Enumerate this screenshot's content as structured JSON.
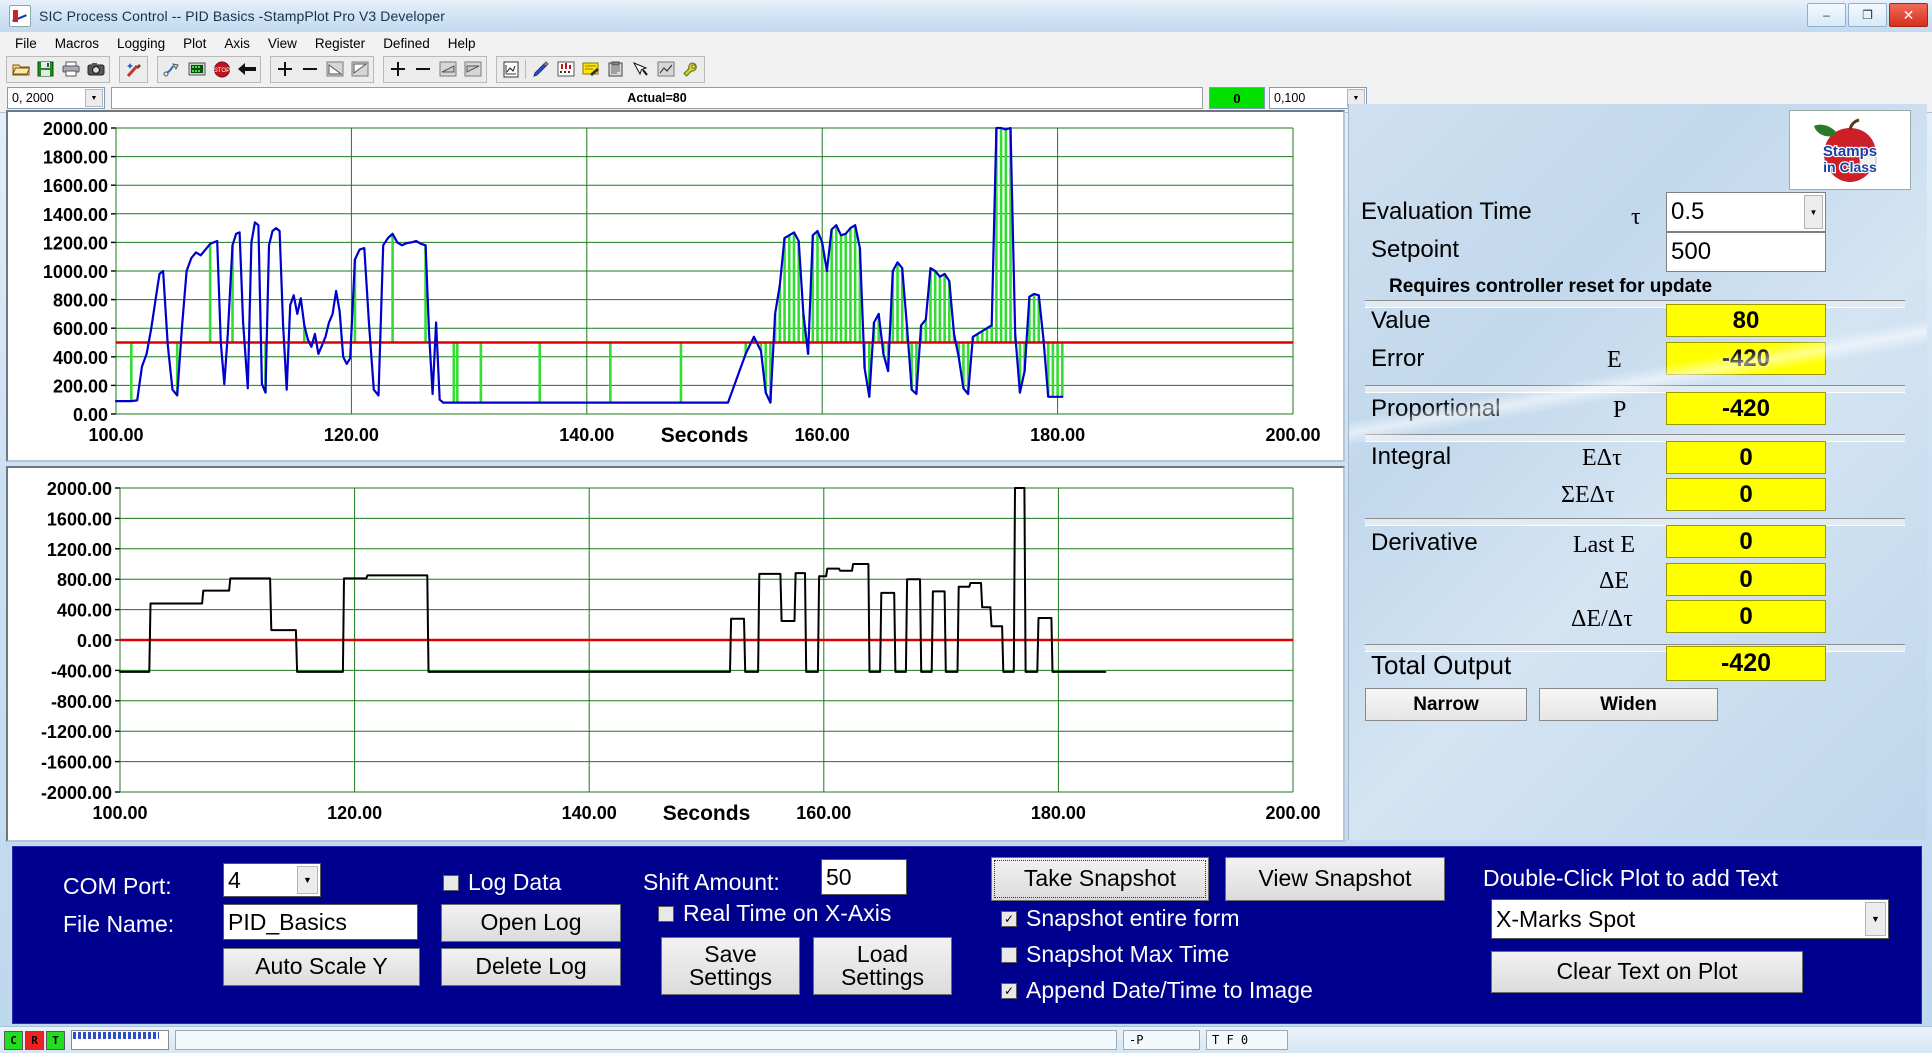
{
  "window": {
    "title": "SIC Process Control -- PID Basics -StampPlot Pro V3 Developer",
    "minimize": "–",
    "maximize": "❐",
    "close": "✕"
  },
  "menu": [
    "File",
    "Macros",
    "Logging",
    "Plot",
    "Axis",
    "View",
    "Register",
    "Defined",
    "Help"
  ],
  "toolbar": {
    "groups": [
      [
        "open-icon",
        "save-icon",
        "print-icon",
        "camera-icon"
      ],
      [
        "wand-icon"
      ],
      [
        "connect-icon",
        "terminal-icon",
        "stop-icon",
        "back-arrow-icon"
      ],
      [
        "plus-icon",
        "minus-icon",
        "scale-up-icon",
        "scale-down-icon"
      ],
      [
        "plus2-icon",
        "minus2-icon",
        "shift-left-icon",
        "shift-right-icon"
      ],
      [
        "graph-icon",
        "pen-icon",
        "marks-icon",
        "notes-icon",
        "clipboard-icon",
        "pointer-icon",
        "trend-icon",
        "wrench-icon"
      ]
    ]
  },
  "fieldrow": {
    "y_range": "0, 2000",
    "actual": "Actual=80",
    "indicator": "0",
    "x_range": "0,100"
  },
  "chart_data": [
    {
      "type": "line",
      "name": "process-value-plot",
      "title": "",
      "xlabel": "Seconds",
      "ylabel": "",
      "xlim": [
        100,
        200
      ],
      "ylim": [
        0,
        2000
      ],
      "xticks": [
        "100.00",
        "120.00",
        "140.00",
        "160.00",
        "180.00",
        "200.00"
      ],
      "yticks": [
        "0.00",
        "200.00",
        "400.00",
        "600.00",
        "800.00",
        "1000.00",
        "1200.00",
        "1400.00",
        "1600.00",
        "1800.00",
        "2000.00"
      ],
      "grid": true,
      "legend": "none",
      "series": [
        {
          "name": "Value",
          "color": "#0000cc",
          "x": [
            100.0,
            100.4,
            101.3,
            101.8,
            102.2,
            102.6,
            103.0,
            103.4,
            103.7,
            104.0,
            104.4,
            104.8,
            105.2,
            105.6,
            106.0,
            106.4,
            106.8,
            107.2,
            107.6,
            108.0,
            108.3,
            108.6,
            108.9,
            109.2,
            109.5,
            109.9,
            110.2,
            110.5,
            110.8,
            111.2,
            111.5,
            111.8,
            112.1,
            112.4,
            112.7,
            113.0,
            113.3,
            113.6,
            113.9,
            114.2,
            114.5,
            114.8,
            115.1,
            115.4,
            115.7,
            116.0,
            116.3,
            116.6,
            116.9,
            117.2,
            117.5,
            117.8,
            118.1,
            118.4,
            118.7,
            119.0,
            119.3,
            119.6,
            119.9,
            120.3,
            120.7,
            121.1,
            121.5,
            121.9,
            122.3,
            122.7,
            123.1,
            123.5,
            123.9,
            124.3,
            124.7,
            125.1,
            125.5,
            125.9,
            126.3,
            126.6,
            126.9,
            127.2,
            127.5,
            127.8,
            128.1,
            128.4,
            128.7,
            129.0,
            131.0,
            136.0,
            142.0,
            148.0,
            152.0,
            153.5,
            154.2,
            154.8,
            155.2,
            155.6,
            156.0,
            156.4,
            156.8,
            157.2,
            157.6,
            158.0,
            158.4,
            158.8,
            159.2,
            159.6,
            160.0,
            160.4,
            160.8,
            161.2,
            161.6,
            162.0,
            162.4,
            162.8,
            163.2,
            163.6,
            164.0,
            164.4,
            164.8,
            165.2,
            165.6,
            166.0,
            166.4,
            166.8,
            167.2,
            167.6,
            168.0,
            168.4,
            168.8,
            169.2,
            169.6,
            170.0,
            170.4,
            170.8,
            171.2,
            171.6,
            172.0,
            172.4,
            172.8,
            173.2,
            173.6,
            174.0,
            174.4,
            174.8,
            175.2,
            175.6,
            176.0,
            176.4,
            176.8,
            177.2,
            177.6,
            178.0,
            178.4,
            178.8,
            179.2,
            179.6,
            180.0,
            180.4,
            184.0
          ],
          "y": [
            90,
            90,
            90,
            95,
            330,
            420,
            600,
            820,
            980,
            1000,
            480,
            170,
            130,
            600,
            1000,
            1090,
            1130,
            1110,
            1150,
            1190,
            1200,
            1210,
            500,
            210,
            560,
            1180,
            1260,
            1270,
            640,
            180,
            1200,
            1340,
            1320,
            210,
            150,
            1180,
            1280,
            1300,
            1280,
            620,
            170,
            760,
            830,
            700,
            810,
            620,
            520,
            470,
            560,
            420,
            480,
            540,
            640,
            700,
            860,
            720,
            400,
            350,
            390,
            1080,
            1150,
            1160,
            620,
            170,
            130,
            1180,
            1230,
            1260,
            1200,
            1180,
            1195,
            1200,
            1210,
            1190,
            1180,
            560,
            140,
            640,
            100,
            80,
            80,
            80,
            80,
            80,
            80,
            80,
            80,
            80,
            80,
            420,
            540,
            440,
            150,
            80,
            700,
            900,
            1230,
            1250,
            1270,
            1210,
            700,
            420,
            1250,
            1280,
            1200,
            1000,
            1290,
            1320,
            1250,
            1260,
            1300,
            1320,
            1160,
            320,
            120,
            640,
            700,
            420,
            300,
            1000,
            1060,
            1020,
            620,
            170,
            140,
            620,
            660,
            1020,
            1000,
            960,
            980,
            930,
            560,
            400,
            180,
            140,
            540,
            560,
            580,
            600,
            620,
            2000,
            2000,
            1990,
            2000,
            560,
            150,
            300,
            820,
            840,
            830,
            520,
            120,
            120,
            120,
            120
          ]
        },
        {
          "name": "Setpoint",
          "color": "#e00000",
          "constant": 500
        }
      ],
      "markers": {
        "color": "#33dd33",
        "description": "vertical green sample bars between trace and setpoint line"
      }
    },
    {
      "type": "line",
      "name": "controller-output-plot",
      "title": "",
      "xlabel": "Seconds",
      "ylabel": "",
      "xlim": [
        100,
        200
      ],
      "ylim": [
        -2000,
        2000
      ],
      "xticks": [
        "100.00",
        "120.00",
        "140.00",
        "160.00",
        "180.00",
        "200.00"
      ],
      "yticks": [
        "-2000.00",
        "-1600.00",
        "-1200.00",
        "-800.00",
        "-400.00",
        "0.00",
        "400.00",
        "800.00",
        "1200.00",
        "1600.00",
        "2000.00"
      ],
      "grid": true,
      "legend": "none",
      "series": [
        {
          "name": "Output",
          "color": "#000000",
          "x": [
            100.0,
            102.5,
            102.6,
            107.0,
            107.1,
            109.3,
            109.4,
            112.8,
            112.9,
            115.0,
            115.1,
            119.0,
            119.1,
            121.0,
            121.1,
            126.2,
            126.3,
            128.5,
            128.6,
            152.0,
            152.1,
            153.2,
            153.3,
            154.4,
            154.5,
            156.3,
            156.4,
            157.5,
            157.6,
            158.4,
            158.5,
            159.5,
            159.6,
            160.2,
            160.3,
            161.3,
            161.4,
            162.4,
            162.5,
            163.8,
            163.9,
            164.8,
            164.9,
            166.0,
            166.1,
            167.0,
            167.1,
            168.2,
            168.3,
            169.2,
            169.3,
            170.3,
            170.4,
            171.4,
            171.5,
            172.4,
            172.5,
            173.4,
            173.5,
            174.2,
            174.3,
            175.2,
            175.3,
            176.2,
            176.3,
            177.1,
            177.2,
            178.2,
            178.3,
            179.4,
            179.5,
            184.0
          ],
          "y": [
            -420,
            -420,
            480,
            480,
            650,
            650,
            810,
            810,
            130,
            130,
            -420,
            -420,
            810,
            810,
            850,
            850,
            -420,
            -420,
            -420,
            -420,
            280,
            280,
            -420,
            -420,
            870,
            870,
            250,
            250,
            880,
            880,
            -420,
            -420,
            840,
            840,
            940,
            940,
            910,
            910,
            1000,
            1000,
            -420,
            -420,
            620,
            620,
            -420,
            -420,
            800,
            800,
            -420,
            -420,
            640,
            640,
            -420,
            -420,
            700,
            700,
            750,
            750,
            430,
            430,
            180,
            180,
            -420,
            -420,
            2000,
            2000,
            -420,
            -420,
            290,
            290,
            -420,
            -420
          ]
        },
        {
          "name": "Zero",
          "color": "#e00000",
          "constant": 0
        }
      ]
    }
  ],
  "panel": {
    "logo_alt": "Stamps in Class",
    "logo_line1": "Stamps",
    "logo_line2": "in Class",
    "eval_time_label": "Evaluation Time",
    "eval_time_symbol": "τ",
    "eval_time_value": "0.5",
    "setpoint_label": "Setpoint",
    "setpoint_value": "500",
    "reset_note": "Requires controller reset for update",
    "value_label": "Value",
    "value_value": "80",
    "error_label": "Error",
    "error_symbol": "E",
    "error_value": "-420",
    "prop_label": "Proportional",
    "prop_symbol": "P",
    "prop_value": "-420",
    "integral_label": "Integral",
    "integral_sym1": "EΔτ",
    "integral_val1": "0",
    "integral_sym2": "ΣEΔτ",
    "integral_val2": "0",
    "deriv_label": "Derivative",
    "deriv_sym1": "Last E",
    "deriv_val1": "0",
    "deriv_sym2": "ΔE",
    "deriv_val2": "0",
    "deriv_sym3": "ΔE/Δτ",
    "deriv_val3": "0",
    "total_label": "Total Output",
    "total_value": "-420",
    "narrow_label": "Narrow",
    "widen_label": "Widen"
  },
  "bottom": {
    "com_port_label": "COM Port:",
    "com_port_value": "4",
    "file_name_label": "File Name:",
    "file_name_value": "PID_Basics",
    "auto_scale_label": "Auto Scale Y",
    "log_data_label": "Log Data",
    "log_data_checked": false,
    "open_log_label": "Open Log",
    "delete_log_label": "Delete Log",
    "shift_amount_label": "Shift Amount:",
    "shift_amount_value": "50",
    "real_time_label": "Real Time on X-Axis",
    "real_time_checked": false,
    "save_settings_label": "Save\nSettings",
    "save_settings_line1": "Save",
    "save_settings_line2": "Settings",
    "load_settings_line1": "Load",
    "load_settings_line2": "Settings",
    "take_snapshot_label": "Take Snapshot",
    "view_snapshot_label": "View Snapshot",
    "snap_form_label": "Snapshot entire form",
    "snap_form_checked": true,
    "snap_max_label": "Snapshot Max Time",
    "snap_max_checked": false,
    "append_dt_label": "Append Date/Time to Image",
    "append_dt_checked": true,
    "dblclick_label": "Double-Click Plot to add Text",
    "text_mode_value": "X-Marks Spot",
    "clear_text_label": "Clear Text on Plot",
    "checkmark": "✓"
  },
  "status": {
    "led_c": "C",
    "led_r": "R",
    "led_t": "T",
    "cell_p": "-P",
    "cell_tf": "T F 0"
  }
}
